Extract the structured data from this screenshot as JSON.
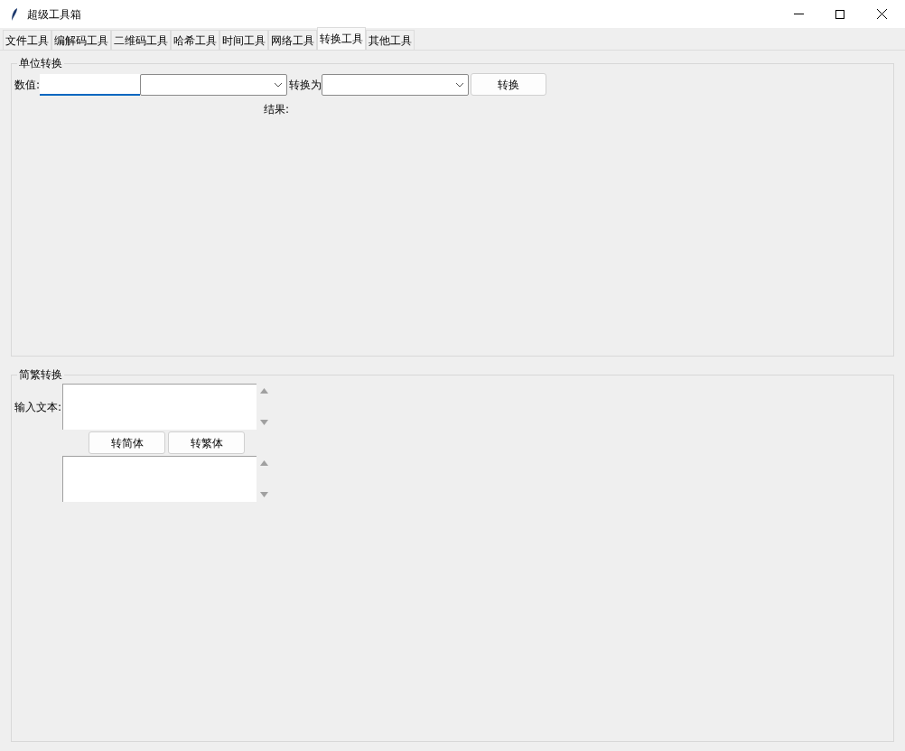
{
  "window": {
    "title": "超级工具箱"
  },
  "tabs": [
    {
      "label": "文件工具",
      "selected": false
    },
    {
      "label": "编解码工具",
      "selected": false
    },
    {
      "label": "二维码工具",
      "selected": false
    },
    {
      "label": "哈希工具",
      "selected": false
    },
    {
      "label": "时间工具",
      "selected": false
    },
    {
      "label": "网络工具",
      "selected": false
    },
    {
      "label": "转换工具",
      "selected": true
    },
    {
      "label": "其他工具",
      "selected": false
    }
  ],
  "unit_conversion": {
    "title": "单位转换",
    "value_label": "数值:",
    "to_label": "转换为",
    "convert_button": "转换",
    "result_label": "结果:"
  },
  "text_conversion": {
    "title": "简繁转换",
    "input_label": "输入文本:",
    "buttons": [
      "转简体",
      "转繁体"
    ]
  }
}
